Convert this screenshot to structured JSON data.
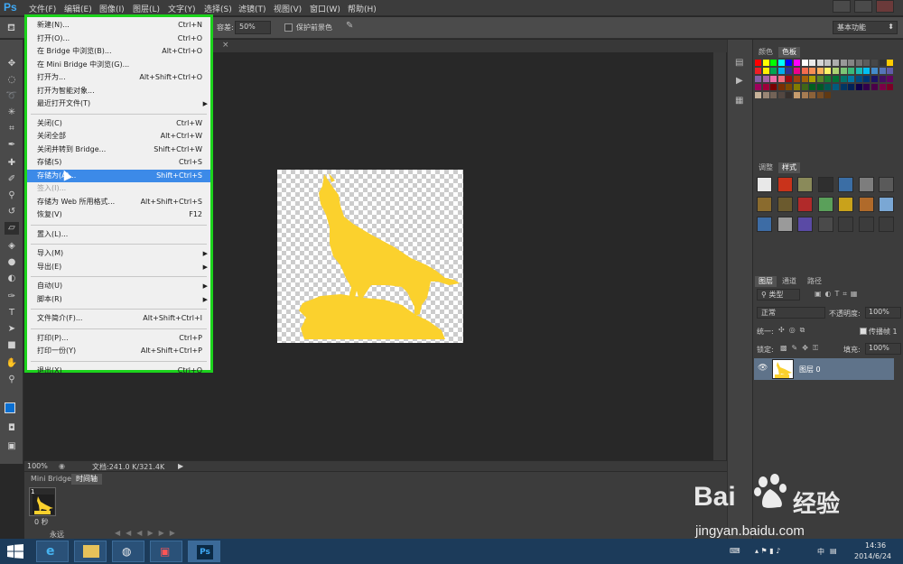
{
  "app": {
    "logo": "Ps"
  },
  "menubar": {
    "items": [
      "文件(F)",
      "编辑(E)",
      "图像(I)",
      "图层(L)",
      "文字(Y)",
      "选择(S)",
      "滤镜(T)",
      "视图(V)",
      "窗口(W)",
      "帮助(H)"
    ]
  },
  "options": {
    "tolerance_label": "容差:",
    "tolerance_value": "50%",
    "protect_fg_label": "保护前景色",
    "workspace": "基本功能"
  },
  "file_menu": {
    "groups": [
      [
        {
          "label": "新建(N)...",
          "shortcut": "Ctrl+N"
        },
        {
          "label": "打开(O)...",
          "shortcut": "Ctrl+O"
        },
        {
          "label": "在 Bridge 中浏览(B)...",
          "shortcut": "Alt+Ctrl+O"
        },
        {
          "label": "在 Mini Bridge 中浏览(G)...",
          "shortcut": ""
        },
        {
          "label": "打开为...",
          "shortcut": "Alt+Shift+Ctrl+O"
        },
        {
          "label": "打开为智能对象...",
          "shortcut": ""
        },
        {
          "label": "最近打开文件(T)",
          "shortcut": "",
          "submenu": true
        }
      ],
      [
        {
          "label": "关闭(C)",
          "shortcut": "Ctrl+W"
        },
        {
          "label": "关闭全部",
          "shortcut": "Alt+Ctrl+W"
        },
        {
          "label": "关闭并转到 Bridge...",
          "shortcut": "Shift+Ctrl+W"
        },
        {
          "label": "存储(S)",
          "shortcut": "Ctrl+S"
        },
        {
          "label": "存储为(A)...",
          "shortcut": "Shift+Ctrl+S",
          "highlighted": true
        },
        {
          "label": "签入(I)...",
          "shortcut": "",
          "disabled": true
        },
        {
          "label": "存储为 Web 所用格式...",
          "shortcut": "Alt+Shift+Ctrl+S"
        },
        {
          "label": "恢复(V)",
          "shortcut": "F12"
        }
      ],
      [
        {
          "label": "置入(L)...",
          "shortcut": ""
        }
      ],
      [
        {
          "label": "导入(M)",
          "shortcut": "",
          "submenu": true
        },
        {
          "label": "导出(E)",
          "shortcut": "",
          "submenu": true
        }
      ],
      [
        {
          "label": "自动(U)",
          "shortcut": "",
          "submenu": true
        },
        {
          "label": "脚本(R)",
          "shortcut": "",
          "submenu": true
        }
      ],
      [
        {
          "label": "文件简介(F)...",
          "shortcut": "Alt+Shift+Ctrl+I"
        }
      ],
      [
        {
          "label": "打印(P)...",
          "shortcut": "Ctrl+P"
        },
        {
          "label": "打印一份(Y)",
          "shortcut": "Alt+Shift+Ctrl+P"
        }
      ],
      [
        {
          "label": "退出(X)",
          "shortcut": "Ctrl+Q"
        }
      ]
    ]
  },
  "status": {
    "zoom": "100%",
    "doc_info": "文档:241.0 K/321.4K"
  },
  "timeline": {
    "tabs": [
      "Mini Bridge",
      "时间轴"
    ],
    "frame_number": "1",
    "frame_delay": "0 秒",
    "loop": "永远"
  },
  "panels": {
    "swatch_tabs": [
      "颜色",
      "色板"
    ],
    "style_tabs": [
      "调整",
      "样式"
    ],
    "layer_tabs": [
      "图层",
      "通道",
      "路径"
    ],
    "filter_kind": "类型",
    "blend_mode": "正常",
    "opacity_label": "不透明度:",
    "opacity_value": "100%",
    "unify_label": "统一:",
    "propagate_label": "传播帧 1",
    "lock_label": "锁定:",
    "fill_label": "填充:",
    "fill_value": "100%",
    "layer_name": "图层 0"
  },
  "taskbar": {
    "ime": "中",
    "time": "14:36",
    "date": "2014/6/24"
  },
  "watermark": {
    "brand": "Bai",
    "brand2": "经验",
    "url": "jingyan.baidu.com"
  },
  "colors": {
    "highlight": "#3c8ae8",
    "menu_border": "#1cd31c",
    "wolf": "#fbd12d"
  }
}
